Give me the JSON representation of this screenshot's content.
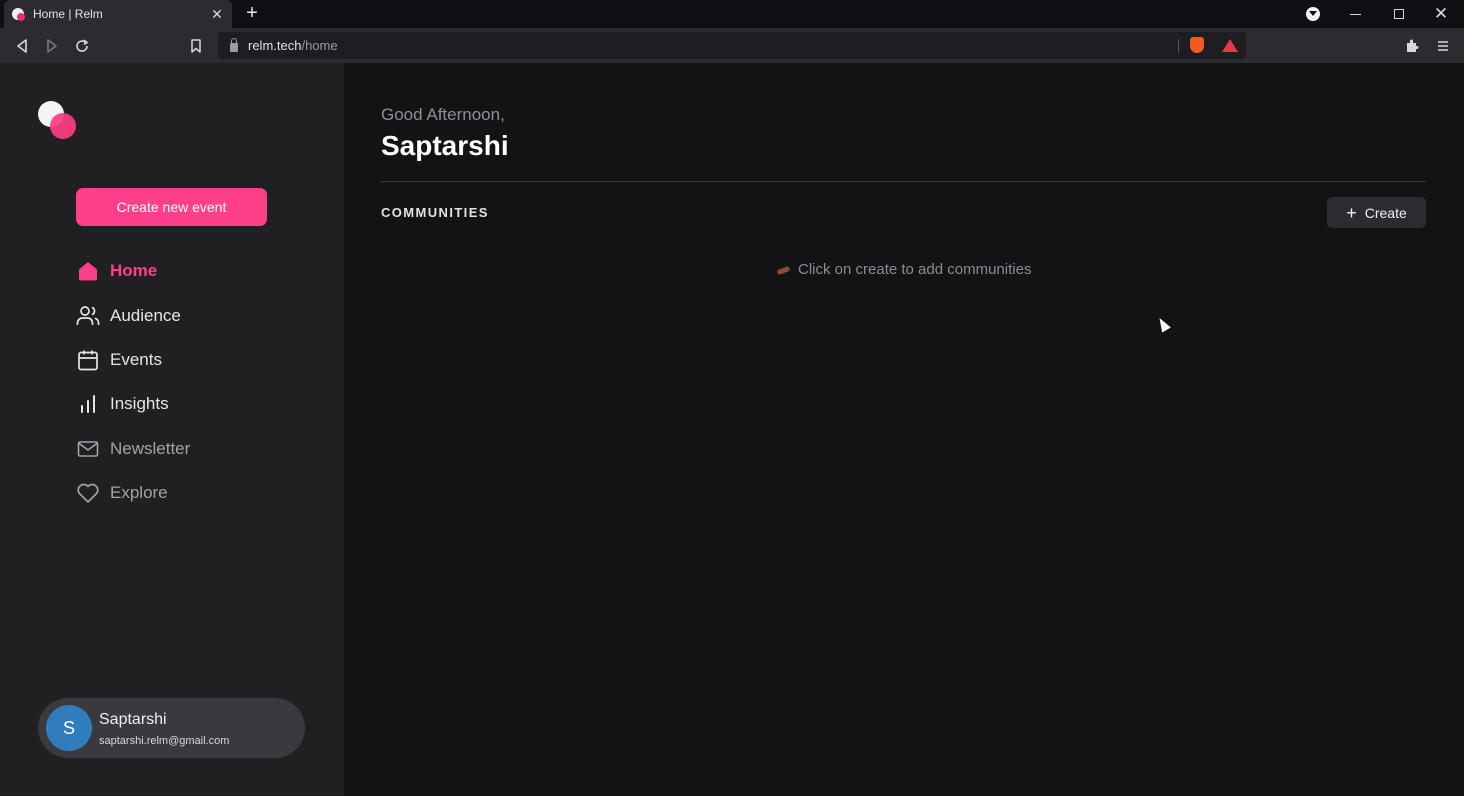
{
  "browser": {
    "tab_title": "Home | Relm",
    "tab_close": "✕",
    "new_tab": "+",
    "url_host": "relm.tech",
    "url_path": "/home",
    "window_close": "✕"
  },
  "sidebar": {
    "create_event_label": "Create new event",
    "nav": [
      {
        "label": "Home",
        "icon": "home-icon",
        "active": true
      },
      {
        "label": "Audience",
        "icon": "users-icon"
      },
      {
        "label": "Events",
        "icon": "calendar-icon"
      },
      {
        "label": "Insights",
        "icon": "bar-chart-icon"
      },
      {
        "label": "Newsletter",
        "icon": "mail-icon"
      },
      {
        "label": "Explore",
        "icon": "heart-icon"
      }
    ],
    "profile": {
      "initial": "S",
      "name": "Saptarshi",
      "email": "saptarshi.relm@gmail.com"
    }
  },
  "main": {
    "greeting": "Good Afternoon,",
    "user_name": "Saptarshi",
    "section_title": "COMMUNITIES",
    "create_label": "Create",
    "create_plus": "+",
    "empty_text": "Click on create to add communities"
  },
  "colors": {
    "accent": "#ff3f89",
    "sidebar_bg": "#202023",
    "main_bg": "#131316",
    "avatar": "#2f7dbd"
  }
}
